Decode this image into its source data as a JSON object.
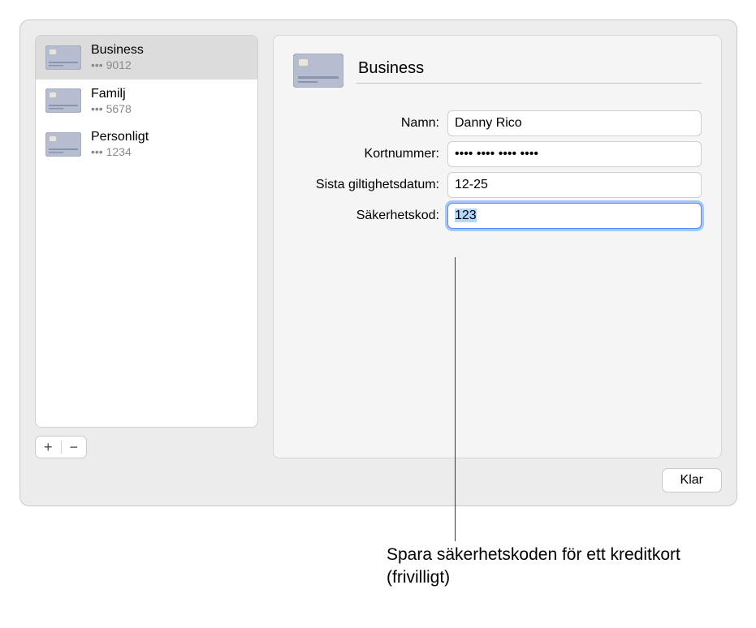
{
  "sidebar": {
    "items": [
      {
        "name": "Business",
        "last4_prefix": "••• ",
        "last4": "9012",
        "selected": true
      },
      {
        "name": "Familj",
        "last4_prefix": "••• ",
        "last4": "5678",
        "selected": false
      },
      {
        "name": "Personligt",
        "last4_prefix": "••• ",
        "last4": "1234",
        "selected": false
      }
    ],
    "add_label": "+",
    "remove_label": "−"
  },
  "detail": {
    "title_value": "Business",
    "fields": {
      "name": {
        "label": "Namn:",
        "value": "Danny Rico"
      },
      "number": {
        "label": "Kortnummer:",
        "value": "•••• •••• •••• ••••"
      },
      "expiry": {
        "label": "Sista giltighetsdatum:",
        "value": "12-25"
      },
      "cvv": {
        "label": "Säkerhetskod:",
        "value": "123",
        "focused": true,
        "selected": true
      }
    }
  },
  "buttons": {
    "done": "Klar"
  },
  "callout": {
    "text": "Spara säkerhetskoden för ett kreditkort (frivilligt)"
  }
}
